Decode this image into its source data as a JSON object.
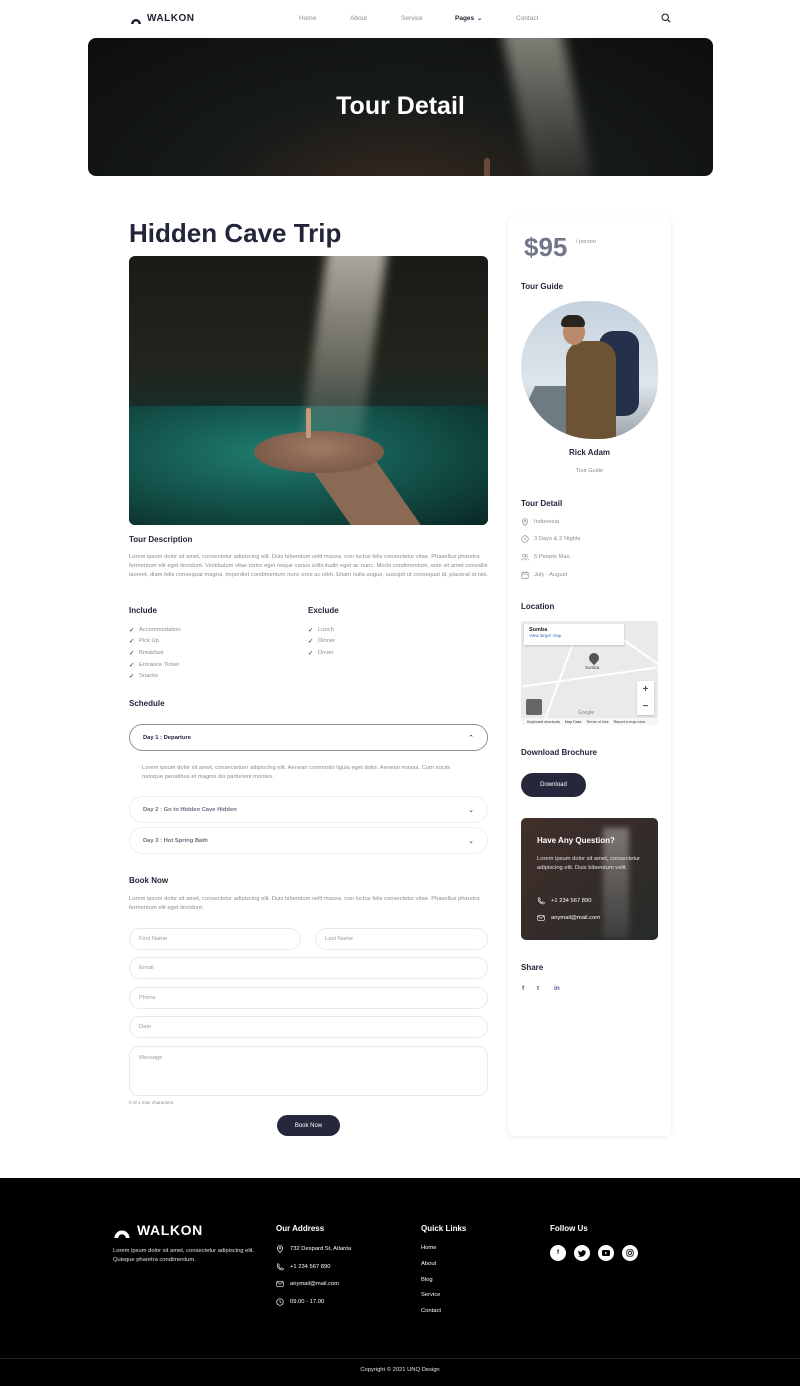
{
  "nav": {
    "brand": "WALKON",
    "items": [
      {
        "label": "Home"
      },
      {
        "label": "About"
      },
      {
        "label": "Service"
      },
      {
        "label": "Pages",
        "chevron": "chevron-down-icon"
      },
      {
        "label": "Contact"
      }
    ],
    "search_icon": "search-icon"
  },
  "hero": {
    "title": "Tour Detail"
  },
  "tour": {
    "title": "Hidden Cave Trip",
    "description_heading": "Tour Description",
    "description": "Lorem ipsum dolor sit amet, consectetur adipiscing elit. Duis bibendum velit massa, non luctus felis consectetur vitae. Phasellus pharetra fermentum elit eget tincidunt. Vestibulum vitae tortor eget neque varius sollicitudin eget ac nunc. Morbi condimentum, ante sit amet convallis laoreet, diam felis consequat magna, imperdiet condimentum nunc eros ac nibh. Etiam nulla augue, suscipit ut consequat id, placerat id nisl.",
    "include_heading": "Include",
    "include": [
      "Accommodation",
      "Pick Up",
      "Breakfast",
      "Entrance Ticket",
      "Snacks"
    ],
    "exclude_heading": "Exclude",
    "exclude": [
      "Lunch",
      "Dinner",
      "Driver"
    ],
    "schedule_heading": "Schedule",
    "schedule": [
      {
        "label": "Day 1 : Departure",
        "open": true,
        "content": "Lorem ipsum dolor sit amet, consectetuer adipiscing elit. Aenean commodo ligula eget dolor. Aenean massa. Cum sociis natoque penatibus et magnis dis parturient montes."
      },
      {
        "label": "Day 2 : Go to Hidden Cave Hidden",
        "open": false
      },
      {
        "label": "Day 3 : Hot Spring Bath",
        "open": false
      }
    ]
  },
  "booking": {
    "heading": "Book Now",
    "text": "Lorem ipsum dolor sit amet, consectetur adipiscing elit. Duis bibendum velit massa, non luctus felis consectetur vitae. Phasellus pharetra fermentum elit eget tincidunt.",
    "first_name_placeholder": "First Name",
    "last_name_placeholder": "Last Name",
    "email_placeholder": "Email",
    "phone_placeholder": "Phone",
    "date_placeholder": "Date",
    "message_placeholder": "Message",
    "char_counter": "0 of 1 max characters.",
    "submit_label": "Book Now"
  },
  "sidebar": {
    "price": "$95",
    "price_unit": "/ person",
    "guide_heading": "Tour Guide",
    "guide_name": "Rick Adam",
    "guide_role": "Tour Guide",
    "detail_heading": "Tour Detail",
    "details": [
      {
        "icon": "location-pin-icon",
        "text": "Indonesia"
      },
      {
        "icon": "clock-icon",
        "text": "3 Days & 2 Nights"
      },
      {
        "icon": "people-icon",
        "text": "5 People Max."
      },
      {
        "icon": "calendar-icon",
        "text": "July - August"
      }
    ],
    "location_heading": "Location",
    "map": {
      "place": "Sumba",
      "view_link": "View larger map",
      "pin_label": "Sumba",
      "google": "Google",
      "footer": [
        "Keyboard shortcuts",
        "Map Data",
        "Terms of Use",
        "Report a map error"
      ]
    },
    "brochure_heading": "Download Brochure",
    "download_label": "Download",
    "question": {
      "title": "Have Any Question?",
      "text": "Lorem ipsum dolor sit amet, consectetur adipiscing elit. Duis bibendum velit.",
      "phone": "+1 234 567 890",
      "email": "anymail@mail.com"
    },
    "share_heading": "Share",
    "share": [
      "f",
      "t",
      "in"
    ]
  },
  "footer": {
    "brand": "WALKON",
    "description": "Lorem ipsum dolor sit amet, consectetur adipiscing elit. Quisque pharetra condimentum.",
    "address_heading": "Our Address",
    "address": [
      {
        "icon": "location-pin-icon",
        "text": "732 Despard St, Atlanta"
      },
      {
        "icon": "phone-icon",
        "text": "+1 234 567 890"
      },
      {
        "icon": "mail-icon",
        "text": "anymail@mail.com"
      },
      {
        "icon": "clock-icon",
        "text": "09.00 - 17.00"
      }
    ],
    "links_heading": "Quick Links",
    "links": [
      "Home",
      "About",
      "Blog",
      "Service",
      "Contact"
    ],
    "follow_heading": "Follow Us",
    "social": [
      "facebook-icon",
      "twitter-icon",
      "youtube-icon",
      "instagram-icon"
    ],
    "copyright": "Copyright © 2021 UNQ Design"
  }
}
